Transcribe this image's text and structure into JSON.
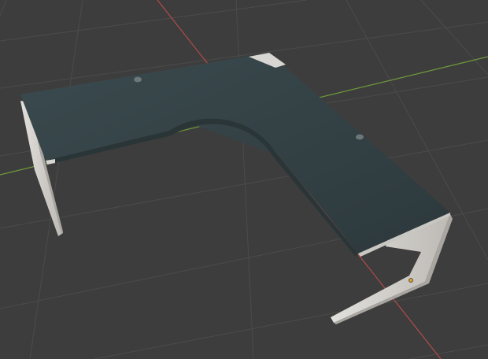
{
  "viewport": {
    "view": "perspective",
    "background_color": "#3d3d3d",
    "grid_color": "#4b4b4b",
    "x_axis_color": "#b34a4a",
    "y_axis_color": "#6f9a3a",
    "show_grid": true,
    "show_axes": true
  },
  "object": {
    "name": "desk",
    "type": "L-shaped desk",
    "top_color": "#344145",
    "leg_color": "#d2d0cc",
    "grommet_count": 2,
    "selected_vertex_color": "#e0a030"
  }
}
